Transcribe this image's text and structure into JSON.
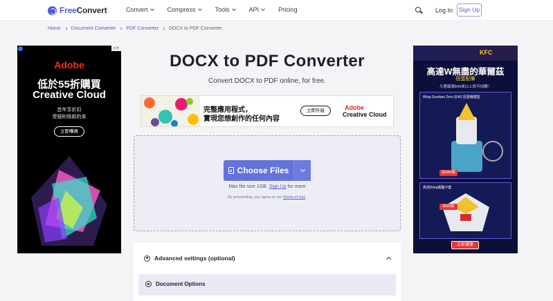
{
  "header": {
    "logo_free": "Free",
    "logo_convert": "Convert",
    "nav": [
      {
        "label": "Convert"
      },
      {
        "label": "Compress"
      },
      {
        "label": "Tools"
      },
      {
        "label": "API"
      },
      {
        "label": "Pricing"
      }
    ],
    "login_label": "Log In",
    "signup_label": "Sign Up"
  },
  "breadcrumb": [
    "Home",
    "Document Converter",
    "PDF Converter",
    "DOCX to PDF Converter"
  ],
  "main": {
    "title": "DOCX to PDF Converter",
    "subtitle": "Convert DOCX to PDF online, for free.",
    "choose_files_label": "Choose Files",
    "max_size_prefix": "Max file size 1GB.",
    "max_size_link": "Sign Up",
    "max_size_suffix": "for more",
    "terms_prefix": "By proceeding, you agree to our",
    "terms_link": "Terms of Use",
    "terms_suffix": ".",
    "advanced_label": "Advanced settings (optional)",
    "document_options_label": "Document Options"
  },
  "ads": {
    "left": {
      "brand": "Adobe",
      "headline1": "低於55折購買",
      "headline2": "Creative Cloud",
      "sub1": "首年享折扣",
      "sub2": "受細則條款約束",
      "cta": "立即購買"
    },
    "center": {
      "line1": "完整應用程式，",
      "line2": "實現您想創作的任何內容",
      "cta": "立即升級",
      "brand1": "Adobe",
      "brand2": "Creative Cloud"
    },
    "right": {
      "brand": "KFC",
      "title": "高達W無盡的華爾茲",
      "subtitle": "扭蛋配備",
      "note": "凡惠顧滿$49或以上即可加購！",
      "product1": "Wing Gundam Zero (EW) 扭蛋機模型",
      "price1": "$268/個",
      "product2": "高達Wing電腦卡套",
      "price2": "$68/個",
      "cta": "立即選單"
    }
  },
  "colors": {
    "accent": "#4f5bd5",
    "button": "#6373d9",
    "adobe_red": "#ff2b1c"
  }
}
